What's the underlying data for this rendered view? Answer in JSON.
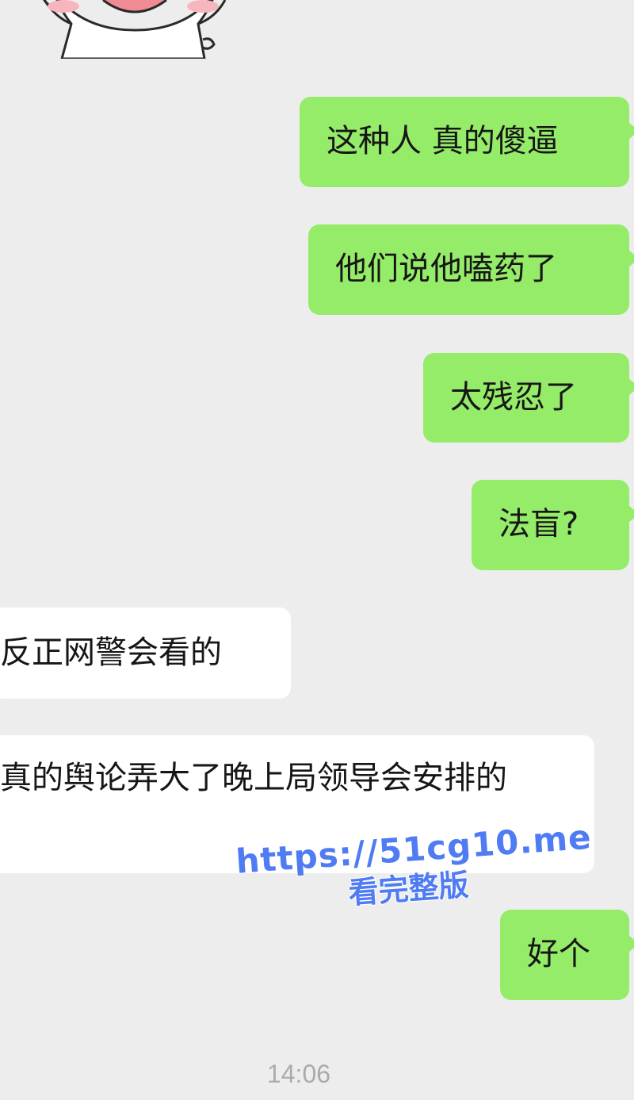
{
  "chat": {
    "messages": [
      {
        "direction": "out",
        "text": "这种人 真的傻逼"
      },
      {
        "direction": "out",
        "text": "他们说他嗑药了"
      },
      {
        "direction": "out",
        "text": "太残忍了"
      },
      {
        "direction": "out",
        "text": "法盲?"
      },
      {
        "direction": "in",
        "text": "反正网警会看的"
      },
      {
        "direction": "in",
        "text": "真的舆论弄大了晚上局领导会安排的"
      },
      {
        "direction": "out",
        "text": "好个"
      }
    ],
    "timestamp": "14:06"
  },
  "watermark": {
    "url": "https://51cg10.me",
    "caption": "看完整版"
  },
  "colors": {
    "background": "#ededed",
    "outgoing_bubble": "#95ec69",
    "incoming_bubble": "#ffffff",
    "watermark": "#4f7bf3",
    "timestamp": "#ababab"
  },
  "sticker": {
    "icon": "bunny-sticker-icon"
  }
}
